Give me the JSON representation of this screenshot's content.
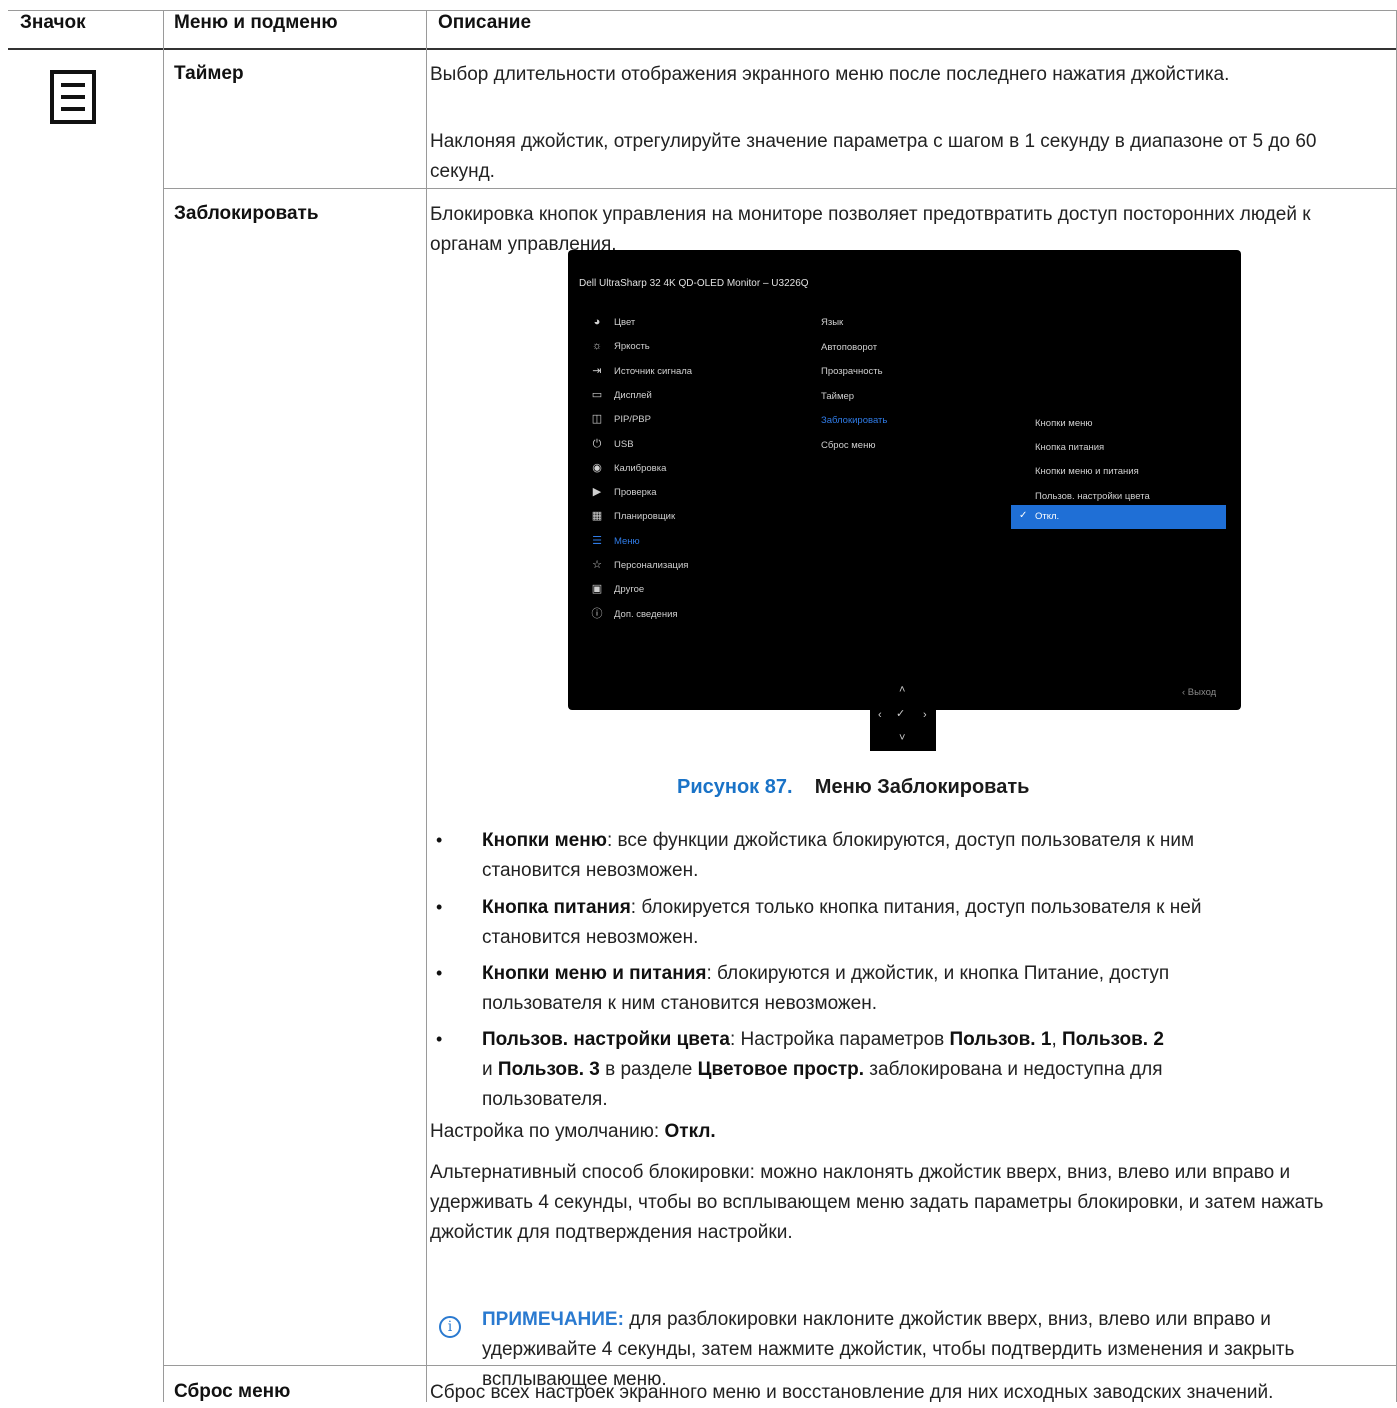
{
  "table": {
    "headers": [
      "Значок",
      "Меню и подменю",
      "Описание"
    ]
  },
  "icon": {
    "name": "menu-icon"
  },
  "rows": {
    "timer": {
      "name": "Таймер",
      "desc1": "Выбор длительности отображения экранного меню после последнего нажатия джойстика.",
      "desc2": "Наклоняя джойстик, отрегулируйте значение параметра с шагом в 1 секунду в диапазоне от 5 до 60 секунд."
    },
    "lock": {
      "name": "Заблокировать",
      "desc1": "Блокировка кнопок управления на мониторе позволяет предотвратить доступ посторонних людей к органам управления."
    },
    "reset": {
      "name": "Сброс меню",
      "desc1": "Сброс всех настроек экранного меню и восстановление для них исходных заводских значений."
    }
  },
  "osd": {
    "title": "Dell UltraSharp 32 4K QD-OLED Monitor – U3226Q",
    "left_menu": [
      {
        "label": "Цвет",
        "icon": "palette-icon"
      },
      {
        "label": "Яркость",
        "icon": "brightness-icon"
      },
      {
        "label": "Источник сигнала",
        "icon": "input-source-icon"
      },
      {
        "label": "Дисплей",
        "icon": "display-icon"
      },
      {
        "label": "PIP/PBP",
        "icon": "pip-pbp-icon"
      },
      {
        "label": "USB",
        "icon": "usb-icon"
      },
      {
        "label": "Калибровка",
        "icon": "calibration-icon"
      },
      {
        "label": "Проверка",
        "icon": "validation-icon"
      },
      {
        "label": "Планировщик",
        "icon": "scheduler-icon"
      },
      {
        "label": "Меню",
        "icon": "menu-icon"
      },
      {
        "label": "Персонализация",
        "icon": "star-icon"
      },
      {
        "label": "Другое",
        "icon": "others-icon"
      },
      {
        "label": "Доп. сведения",
        "icon": "info-icon"
      }
    ],
    "active_left": "Меню",
    "mid_menu": [
      "Язык",
      "Автоповорот",
      "Прозрачность",
      "Таймер",
      "Заблокировать",
      "Сброс меню"
    ],
    "active_mid": "Заблокировать",
    "right_menu": [
      "Кнопки меню",
      "Кнопка питания",
      "Кнопки меню и питания",
      "Пользов. настройки цвета",
      "Откл."
    ],
    "selected_right": "Откл.",
    "exit": "‹  Выход"
  },
  "caption": {
    "number": "Рисунок 87.",
    "title": "Меню Заблокировать"
  },
  "bullets": [
    {
      "bold": "Кнопки меню",
      "text": ": все функции джойстика блокируются, доступ пользователя к ним",
      "text2": "становится невозможен."
    },
    {
      "bold": "Кнопка питания",
      "text": ": блокируется только кнопка питания, доступ пользователя к ней",
      "text2": "становится невозможен."
    },
    {
      "bold": "Кнопки меню и питания",
      "text": ": блокируются и джойстик, и кнопка Питание, доступ",
      "text2": "пользователя к ним становится невозможен."
    }
  ],
  "bullet4": {
    "b1": "Пользов. настройки цвета",
    "t1": ": Настройка параметров ",
    "b2": "Пользов. 1",
    "t2": ", ",
    "b3": "Пользов. 2",
    "t3": "и ",
    "b4": "Пользов. 3",
    "t4": " в разделе ",
    "b5": "Цветовое простр.",
    "t5": " заблокирована и недоступна для",
    "t6": "пользователя."
  },
  "default": {
    "label": "Настройка по умолчанию: ",
    "value": "Откл."
  },
  "alt": "Альтернативный способ блокировки: можно наклонять джойстик вверх, вниз, влево или вправо и удерживать 4 секунды, чтобы во всплывающем меню задать параметры блокировки, и затем нажать джойстик для подтверждения настройки.",
  "note": {
    "label": "ПРИМЕЧАНИЕ:",
    "text": " для разблокировки наклоните джойстик вверх, вниз, влево или вправо и удерживайте 4 секунды, затем нажмите джойстик, чтобы подтвердить изменения и закрыть всплывающее меню."
  }
}
